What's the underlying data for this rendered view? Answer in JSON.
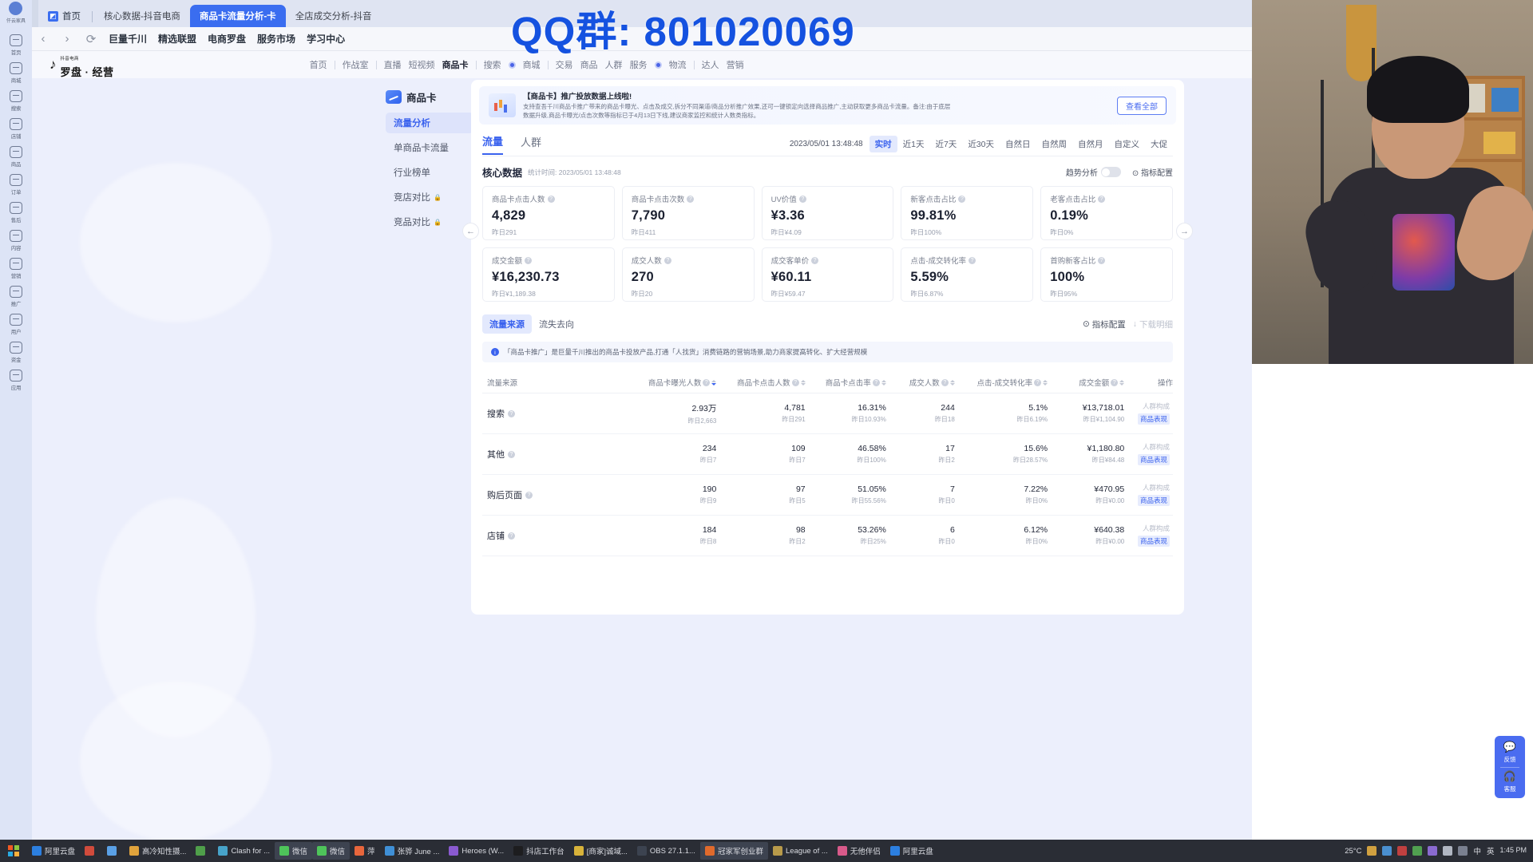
{
  "browser": {
    "tabs": [
      {
        "label": "首页",
        "active": false,
        "home": true
      },
      {
        "label": "核心数据-抖音电商",
        "active": false
      },
      {
        "label": "商品卡流量分析-卡",
        "active": true
      },
      {
        "label": "全店成交分析-抖音",
        "active": false
      }
    ],
    "nav_buttons": [
      "‹",
      "›",
      "⟳"
    ],
    "bookmarks": [
      "巨量千川",
      "精选联盟",
      "电商罗盘",
      "服务市场",
      "学习中心"
    ]
  },
  "left_rail": {
    "account": "仟云家具",
    "items": [
      {
        "label": "首页",
        "icon": "home-icon"
      },
      {
        "label": "商城",
        "icon": "mall-icon"
      },
      {
        "label": "搜索",
        "icon": "search-icon"
      },
      {
        "label": "店铺",
        "icon": "shop-icon"
      },
      {
        "label": "商品",
        "icon": "goods-icon"
      },
      {
        "label": "订单",
        "icon": "order-icon"
      },
      {
        "label": "售后",
        "icon": "aftersale-icon"
      },
      {
        "label": "内容",
        "icon": "content-icon"
      },
      {
        "label": "营销",
        "icon": "marketing-icon"
      },
      {
        "label": "推广",
        "icon": "promotion-icon"
      },
      {
        "label": "用户",
        "icon": "user-icon"
      },
      {
        "label": "资金",
        "icon": "fund-icon"
      },
      {
        "label": "应用",
        "icon": "app-icon"
      }
    ]
  },
  "site_header": {
    "logo_small": "抖音电商",
    "logo_main": "罗盘 · 经营",
    "nav": [
      {
        "label": "首页",
        "active": false,
        "divider_after": true
      },
      {
        "label": "作战室",
        "active": false,
        "divider_after": true
      },
      {
        "label": "直播",
        "active": false
      },
      {
        "label": "短视频",
        "active": false
      },
      {
        "label": "商品卡",
        "active": true,
        "divider_after": true
      },
      {
        "label": "搜索",
        "active": false,
        "dot_after": true
      },
      {
        "label": "商城",
        "active": false,
        "divider_after": true
      },
      {
        "label": "交易",
        "active": false
      },
      {
        "label": "商品",
        "active": false
      },
      {
        "label": "人群",
        "active": false
      },
      {
        "label": "服务",
        "active": false,
        "dot_after": true
      },
      {
        "label": "物流",
        "active": false,
        "divider_after": true
      },
      {
        "label": "达人",
        "active": false
      },
      {
        "label": "营销",
        "active": false
      }
    ]
  },
  "sub_sidebar": {
    "title": "商品卡",
    "items": [
      {
        "label": "流量分析",
        "active": true,
        "locked": false
      },
      {
        "label": "单商品卡流量",
        "active": false,
        "locked": false
      },
      {
        "label": "行业榜单",
        "active": false,
        "locked": false
      },
      {
        "label": "竞店对比",
        "active": false,
        "locked": true
      },
      {
        "label": "竞品对比",
        "active": false,
        "locked": true
      }
    ]
  },
  "banner": {
    "title": "【商品卡】推广投放数据上线啦!",
    "line1": "支持查吾千川商品卡推广带来的商品卡曝光、点击及成交,拆分不同渠道/商品分析推广效果,还可一键锁定向选择商品推广,主动获取更多商品卡流量。备注:由于底层",
    "line2": "数据升级,商品卡曝光/点击次数等指标已于4月13日下线,建议商家监控和统计人数类指标。",
    "button": "查看全部"
  },
  "page_tabs": [
    {
      "label": "流量",
      "active": true
    },
    {
      "label": "人群",
      "active": false
    }
  ],
  "date_bar": {
    "timestamp": "2023/05/01 13:48:48",
    "ranges": [
      {
        "label": "实时",
        "active": true
      },
      {
        "label": "近1天",
        "active": false
      },
      {
        "label": "近7天",
        "active": false
      },
      {
        "label": "近30天",
        "active": false
      },
      {
        "label": "自然日",
        "active": false
      },
      {
        "label": "自然周",
        "active": false
      },
      {
        "label": "自然月",
        "active": false
      },
      {
        "label": "自定义",
        "active": false
      },
      {
        "label": "大促",
        "active": false
      }
    ]
  },
  "core": {
    "title": "核心数据",
    "subtitle": "统计时间: 2023/05/01 13:48:48",
    "trend_label": "趋势分析",
    "config_label": "指标配置"
  },
  "metric_cards": [
    [
      {
        "label": "商品卡点击人数",
        "value": "4,829",
        "sub": "昨日291"
      },
      {
        "label": "商品卡点击次数",
        "value": "7,790",
        "sub": "昨日411"
      },
      {
        "label": "UV价值",
        "value": "¥3.36",
        "sub": "昨日¥4.09"
      },
      {
        "label": "新客点击占比",
        "value": "99.81%",
        "sub": "昨日100%"
      },
      {
        "label": "老客点击占比",
        "value": "0.19%",
        "sub": "昨日0%"
      }
    ],
    [
      {
        "label": "成交金额",
        "value": "¥16,230.73",
        "sub": "昨日¥1,189.38"
      },
      {
        "label": "成交人数",
        "value": "270",
        "sub": "昨日20"
      },
      {
        "label": "成交客单价",
        "value": "¥60.11",
        "sub": "昨日¥59.47"
      },
      {
        "label": "点击-成交转化率",
        "value": "5.59%",
        "sub": "昨日6.87%"
      },
      {
        "label": "首购新客占比",
        "value": "100%",
        "sub": "昨日95%"
      }
    ]
  ],
  "source_section": {
    "tabs": [
      {
        "label": "流量来源",
        "active": true
      },
      {
        "label": "流失去向",
        "active": false
      }
    ],
    "config_btn": "指标配置",
    "download_btn": "下载明细",
    "tip": "「商品卡推广」是巨量千川推出的商品卡投放产品,打通「人找货」消费链路的营销场景,助力商家提高转化、扩大经营规模"
  },
  "table": {
    "headers": [
      {
        "label": "流量来源",
        "sortable": false,
        "help": false
      },
      {
        "label": "商品卡曝光人数",
        "sortable": true,
        "help": true,
        "sorted": true
      },
      {
        "label": "商品卡点击人数",
        "sortable": true,
        "help": true
      },
      {
        "label": "商品卡点击率",
        "sortable": true,
        "help": true
      },
      {
        "label": "成交人数",
        "sortable": true,
        "help": true
      },
      {
        "label": "点击-成交转化率",
        "sortable": true,
        "help": true
      },
      {
        "label": "成交金额",
        "sortable": true,
        "help": true
      },
      {
        "label": "操作",
        "sortable": false,
        "help": false
      }
    ],
    "rows": [
      {
        "name": "搜索",
        "cells": [
          {
            "main": "2.93万",
            "sub": "昨日2,663"
          },
          {
            "main": "4,781",
            "sub": "昨日291"
          },
          {
            "main": "16.31%",
            "sub": "昨日10.93%"
          },
          {
            "main": "244",
            "sub": "昨日18"
          },
          {
            "main": "5.1%",
            "sub": "昨日6.19%"
          },
          {
            "main": "¥13,718.01",
            "sub": "昨日¥1,104.90"
          }
        ],
        "op1": "人群构成",
        "op2": "商品表现"
      },
      {
        "name": "其他",
        "cells": [
          {
            "main": "234",
            "sub": "昨日7"
          },
          {
            "main": "109",
            "sub": "昨日7"
          },
          {
            "main": "46.58%",
            "sub": "昨日100%"
          },
          {
            "main": "17",
            "sub": "昨日2"
          },
          {
            "main": "15.6%",
            "sub": "昨日28.57%"
          },
          {
            "main": "¥1,180.80",
            "sub": "昨日¥84.48"
          }
        ],
        "op1": "人群构成",
        "op2": "商品表现"
      },
      {
        "name": "购后页面",
        "cells": [
          {
            "main": "190",
            "sub": "昨日9"
          },
          {
            "main": "97",
            "sub": "昨日5"
          },
          {
            "main": "51.05%",
            "sub": "昨日55.56%"
          },
          {
            "main": "7",
            "sub": "昨日0"
          },
          {
            "main": "7.22%",
            "sub": "昨日0%"
          },
          {
            "main": "¥470.95",
            "sub": "昨日¥0.00"
          }
        ],
        "op1": "人群构成",
        "op2": "商品表现"
      },
      {
        "name": "店铺",
        "cells": [
          {
            "main": "184",
            "sub": "昨日8"
          },
          {
            "main": "98",
            "sub": "昨日2"
          },
          {
            "main": "53.26%",
            "sub": "昨日25%"
          },
          {
            "main": "6",
            "sub": "昨日0"
          },
          {
            "main": "6.12%",
            "sub": "昨日0%"
          },
          {
            "main": "¥640.38",
            "sub": "昨日¥0.00"
          }
        ],
        "op1": "人群构成",
        "op2": "商品表现"
      }
    ]
  },
  "overlay": {
    "text": "QQ群: 801020069"
  },
  "feedback": {
    "label1": "反馈",
    "label2": "客服"
  },
  "taskbar": {
    "items": [
      {
        "label": "阿里云盘",
        "color": "#2c7fe0",
        "active": false
      },
      {
        "label": "",
        "color": "#d14b3c",
        "active": false
      },
      {
        "label": "",
        "color": "#5aa0e6",
        "active": false
      },
      {
        "label": "高冷知性摄...",
        "color": "#e0a33c",
        "active": false
      },
      {
        "label": "",
        "color": "#4f9f4a",
        "active": false
      },
      {
        "label": "Clash for ...",
        "color": "#47a3c9",
        "active": false
      },
      {
        "label": "微信",
        "color": "#4ec45a",
        "active": true
      },
      {
        "label": "微信",
        "color": "#4ec45a",
        "active": true
      },
      {
        "label": "萍",
        "color": "#e8663c",
        "active": false
      },
      {
        "label": "张骅 June ...",
        "color": "#3f8fd6",
        "active": false
      },
      {
        "label": "Heroes (W...",
        "color": "#8a5ad0",
        "active": false
      },
      {
        "label": "抖店工作台",
        "color": "#1d1d1f",
        "active": false
      },
      {
        "label": "[商家]诚域...",
        "color": "#d8b33a",
        "active": false
      },
      {
        "label": "OBS 27.1.1...",
        "color": "#3c4350",
        "active": false
      },
      {
        "label": "冠家军创业群",
        "color": "#e06a2c",
        "active": true
      },
      {
        "label": "League of ...",
        "color": "#b89a4a",
        "active": false
      },
      {
        "label": "无他伴侣",
        "color": "#d85a8a",
        "active": false
      },
      {
        "label": "阿里云盘",
        "color": "#2c7fe0",
        "active": false
      }
    ],
    "temperature": "25°C",
    "ime": "中",
    "lang": "英",
    "clock_time": "1:45 PM"
  }
}
